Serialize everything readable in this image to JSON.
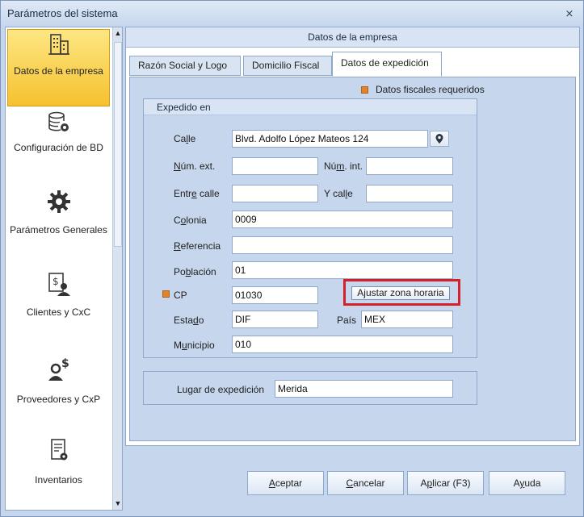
{
  "window": {
    "title": "Parámetros del sistema",
    "close_glyph": "⨯"
  },
  "sidebar": {
    "items": [
      {
        "label": "Datos de la empresa",
        "icon": "building-icon",
        "active": true
      },
      {
        "label": "Configuración de BD",
        "icon": "database-gear-icon"
      },
      {
        "label": "Parámetros Generales",
        "icon": "gear-icon"
      },
      {
        "label": "Clientes y CxC",
        "icon": "clients-money-icon"
      },
      {
        "label": "Proveedores y CxP",
        "icon": "supplier-money-icon"
      },
      {
        "label": "Inventarios",
        "icon": "inventory-icon"
      }
    ]
  },
  "main": {
    "header": "Datos de la empresa",
    "tabs": [
      {
        "label": "Razón Social y Logo"
      },
      {
        "label": "Domicilio Fiscal"
      },
      {
        "label": "Datos de expedición",
        "active": true
      }
    ],
    "legend": "Datos fiscales requeridos",
    "expedido": {
      "title": "Expedido en",
      "fields": {
        "calle": {
          "label_pre": "Ca",
          "label_u": "l",
          "label_post": "le",
          "value": "Blvd. Adolfo López Mateos 124"
        },
        "num_ext": {
          "label_pre": "",
          "label_u": "N",
          "label_post": "úm. ext.",
          "value": ""
        },
        "num_int": {
          "label_pre": "Nú",
          "label_u": "m",
          "label_post": ". int.",
          "value": ""
        },
        "entre_calle": {
          "label_pre": "Entr",
          "label_u": "e",
          "label_post": " calle",
          "value": ""
        },
        "y_calle": {
          "label_pre": "Y cal",
          "label_u": "l",
          "label_post": "e",
          "value": ""
        },
        "colonia": {
          "label_pre": "C",
          "label_u": "o",
          "label_post": "lonia",
          "value": "0009"
        },
        "referencia": {
          "label_pre": "",
          "label_u": "R",
          "label_post": "eferencia",
          "value": ""
        },
        "poblacion": {
          "label_pre": "Po",
          "label_u": "b",
          "label_post": "lación",
          "value": "01"
        },
        "cp": {
          "label": "CP",
          "value": "01030"
        },
        "estado": {
          "label_pre": "Esta",
          "label_u": "d",
          "label_post": "o",
          "value": "DIF"
        },
        "pais": {
          "label_pre": "País",
          "label_u": "",
          "label_post": "",
          "value": "MEX"
        },
        "municipio": {
          "label_pre": "M",
          "label_u": "u",
          "label_post": "nicipio",
          "value": "010"
        }
      },
      "ajustar_label": "Ajustar zona horaria"
    },
    "lugar": {
      "label": "Lugar de expedición",
      "value": "Merida"
    }
  },
  "buttons": {
    "aceptar": {
      "u": "A",
      "rest": "ceptar"
    },
    "cancelar": {
      "u": "C",
      "rest": "ancelar"
    },
    "aplicar": {
      "pre": "A",
      "u": "p",
      "rest": "licar (F3)"
    },
    "ayuda": {
      "pre": "A",
      "u": "y",
      "rest": "uda"
    }
  },
  "colors": {
    "required_marker": "#e2822a",
    "highlight_border": "#d3202a",
    "active_item": "#f6c12e"
  }
}
